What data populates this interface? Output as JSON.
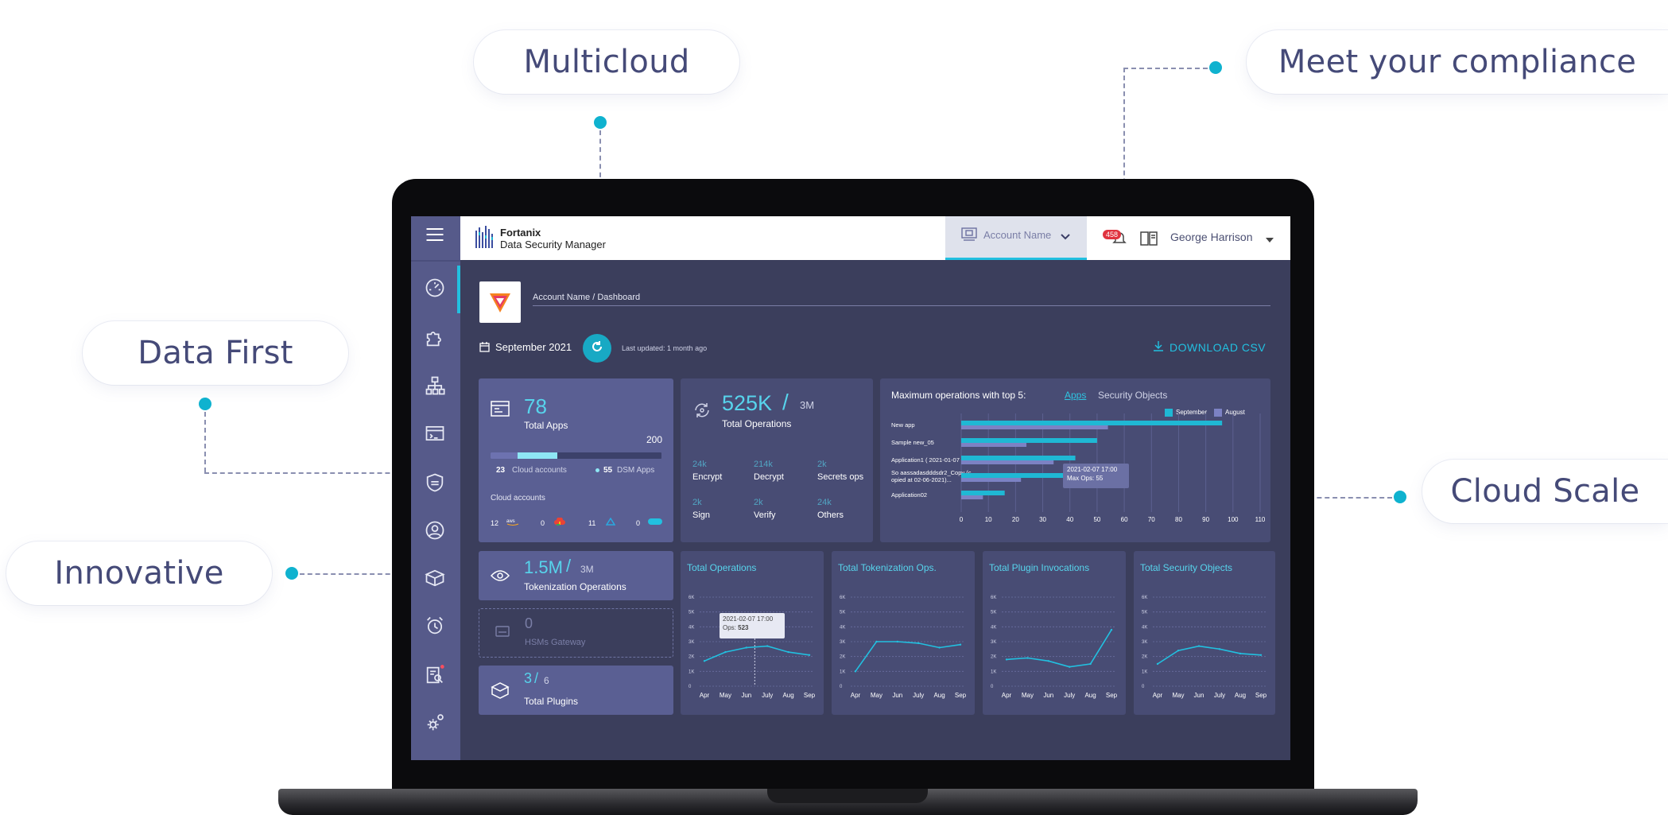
{
  "callouts": {
    "multicloud": "Multicloud",
    "compliance": "Meet your compliance",
    "data_first": "Data First",
    "innovative": "Innovative",
    "cloud_scale": "Cloud Scale"
  },
  "colors": {
    "accent": "#0fb2cf",
    "panel": "#48504f",
    "sidebar": "#565a8a",
    "september": "#1fb8d4",
    "august": "#7c82c4"
  },
  "header": {
    "brand": "Fortanix",
    "product": "Data Security Manager",
    "account_selector": "Account Name",
    "notification_count": "458",
    "user_name": "George Harrison"
  },
  "breadcrumb": "Account Name / Dashboard",
  "toolbar": {
    "date": "September 2021",
    "last_updated": "Last updated: 1 month ago",
    "download": "DOWNLOAD CSV"
  },
  "sidebar": {
    "icons": [
      "dashboard-gauge-icon",
      "puzzle-icon",
      "hierarchy-icon",
      "terminal-window-icon",
      "shield-icon",
      "user-circle-icon",
      "box-icon",
      "alarm-clock-icon",
      "report-search-icon",
      "settings-gear-icon"
    ]
  },
  "apps_card": {
    "count": "78",
    "label": "Total Apps",
    "max": "200",
    "cloud_count": "23",
    "cloud_label": "Cloud accounts",
    "dsm_count": "55",
    "dsm_label": "DSM Apps",
    "progress": 0.39,
    "cloud_title": "Cloud accounts",
    "providers": [
      {
        "count": "12",
        "name": "aws"
      },
      {
        "count": "0",
        "name": "gcp"
      },
      {
        "count": "11",
        "name": "azure"
      },
      {
        "count": "0",
        "name": "other"
      }
    ]
  },
  "ops_card": {
    "value": "525K",
    "slash": "/",
    "max": "3M",
    "label": "Total Operations",
    "stats": [
      {
        "value": "24k",
        "label": "Encrypt"
      },
      {
        "value": "214k",
        "label": "Decrypt"
      },
      {
        "value": "2k",
        "label": "Secrets ops"
      },
      {
        "value": "2k",
        "label": "Sign"
      },
      {
        "value": "2k",
        "label": "Verify"
      },
      {
        "value": "24k",
        "label": "Others"
      }
    ]
  },
  "top5_card": {
    "title": "Maximum operations with top 5:",
    "tab_apps": "Apps",
    "tab_security": "Security Objects",
    "legend_sep": "September",
    "legend_aug": "August",
    "tooltip_date": "2021-02-07 17:00",
    "tooltip_ops": "Max Ops: 55"
  },
  "tokenization_card": {
    "value": "1.5M",
    "slash": "/",
    "max": "3M",
    "label": "Tokenization Operations"
  },
  "hsm_card": {
    "value": "0",
    "label": "HSMs Gateway"
  },
  "plugins_card": {
    "value": "3",
    "slash": "/",
    "max": "6",
    "label": "Total Plugins"
  },
  "line_panels": {
    "titles": [
      "Total Operations",
      "Total Tokenization Ops.",
      "Total Plugin Invocations",
      "Total Security Objects"
    ],
    "tooltip_date": "2021-02-07 17:00",
    "tooltip_ops_label": "Ops:",
    "tooltip_ops_value": "523"
  },
  "chart_data": [
    {
      "type": "bar",
      "orientation": "horizontal",
      "categories": [
        "New app",
        "Sample new_05",
        "Application1 ( 2021-01-07 )",
        "So aassadasdddsdr2_Copy (copied at 02-06-2021)...",
        "Application02"
      ],
      "series": [
        {
          "name": "September",
          "values": [
            96,
            50,
            42,
            40,
            16
          ]
        },
        {
          "name": "August",
          "values": [
            54,
            24,
            34,
            22,
            8
          ]
        }
      ],
      "xticks": [
        0,
        10,
        20,
        30,
        40,
        50,
        60,
        70,
        80,
        90,
        100,
        110
      ],
      "xlim": [
        0,
        110
      ],
      "legend": "top-right"
    },
    {
      "type": "line",
      "x": [
        "Apr",
        "May",
        "Jun",
        "July",
        "Aug",
        "Sep"
      ],
      "yticks": [
        "0",
        "1K",
        "2K",
        "3K",
        "4K",
        "5K",
        "6K"
      ],
      "ylim": [
        0,
        6
      ],
      "series": [
        {
          "values": [
            1.7,
            2.3,
            2.6,
            2.7,
            2.3,
            2.1
          ]
        }
      ]
    },
    {
      "type": "line",
      "x": [
        "Apr",
        "May",
        "Jun",
        "July",
        "Aug",
        "Sep"
      ],
      "yticks": [
        "0",
        "1K",
        "2K",
        "3K",
        "4K",
        "5K",
        "6K"
      ],
      "ylim": [
        0,
        6
      ],
      "series": [
        {
          "values": [
            1.0,
            3.0,
            3.0,
            2.9,
            2.6,
            2.8
          ]
        }
      ]
    },
    {
      "type": "line",
      "x": [
        "Apr",
        "May",
        "Jun",
        "July",
        "Aug",
        "Sep"
      ],
      "yticks": [
        "0",
        "1K",
        "2K",
        "3K",
        "4K",
        "5K",
        "6K"
      ],
      "ylim": [
        0,
        6
      ],
      "series": [
        {
          "values": [
            1.8,
            1.9,
            1.7,
            1.3,
            1.5,
            3.8
          ]
        }
      ]
    },
    {
      "type": "line",
      "x": [
        "Apr",
        "May",
        "Jun",
        "July",
        "Aug",
        "Sep"
      ],
      "yticks": [
        "0",
        "1K",
        "2K",
        "3K",
        "4K",
        "5K",
        "6K"
      ],
      "ylim": [
        0,
        6
      ],
      "series": [
        {
          "values": [
            1.5,
            2.4,
            2.7,
            2.5,
            2.2,
            2.1
          ]
        }
      ]
    }
  ]
}
